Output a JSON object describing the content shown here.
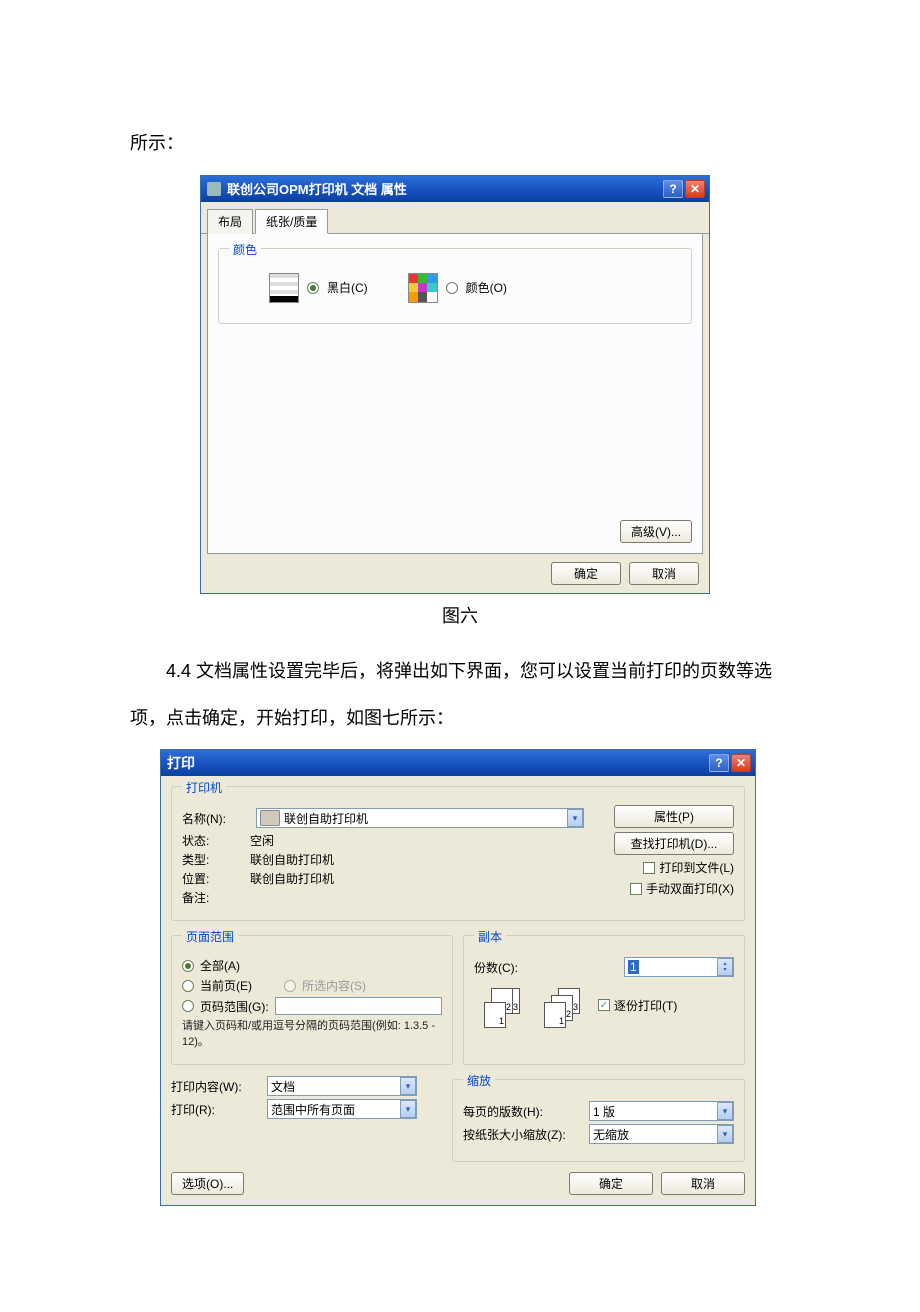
{
  "text": {
    "intro_top": "所示：",
    "caption1": "图六",
    "para44": "4.4 文档属性设置完毕后，将弹出如下界面，您可以设置当前打印的页数等选项，点击确定，开始打印，如图七所示："
  },
  "dlg1": {
    "title": "联创公司OPM打印机 文档 属性",
    "tab_layout": "布局",
    "tab_paper": "纸张/质量",
    "group_color": "颜色",
    "radio_bw": "黑白(C)",
    "radio_color": "颜色(O)",
    "btn_advanced": "高级(V)...",
    "btn_ok": "确定",
    "btn_cancel": "取消"
  },
  "dlg2": {
    "title": "打印",
    "group_printer": "打印机",
    "lbl_name": "名称(N):",
    "printer_name": "联创自助打印机",
    "lbl_status": "状态:",
    "val_status": "空闲",
    "lbl_type": "类型:",
    "val_type": "联创自助打印机",
    "lbl_location": "位置:",
    "val_location": "联创自助打印机",
    "lbl_comment": "备注:",
    "val_comment": "",
    "btn_properties": "属性(P)",
    "btn_find": "查找打印机(D)...",
    "chk_to_file": "打印到文件(L)",
    "chk_manual_duplex": "手动双面打印(X)",
    "group_range": "页面范围",
    "radio_all": "全部(A)",
    "radio_current": "当前页(E)",
    "radio_selection": "所选内容(S)",
    "radio_pages": "页码范围(G):",
    "help_range": "请键入页码和/或用逗号分隔的页码范围(例如: 1.3.5 - 12)。",
    "group_copies": "副本",
    "lbl_copies": "份数(C):",
    "val_copies": "1",
    "chk_collate": "逐份打印(T)",
    "lbl_print_what": "打印内容(W):",
    "val_print_what": "文档",
    "lbl_print": "打印(R):",
    "val_print": "范围中所有页面",
    "group_zoom": "缩放",
    "lbl_pps": "每页的版数(H):",
    "val_pps": "1 版",
    "lbl_scale": "按纸张大小缩放(Z):",
    "val_scale": "无缩放",
    "btn_options": "选项(O)...",
    "btn_ok": "确定",
    "btn_cancel": "取消",
    "stack_labels": [
      "3",
      "2",
      "1",
      "3",
      "2",
      "1"
    ]
  }
}
